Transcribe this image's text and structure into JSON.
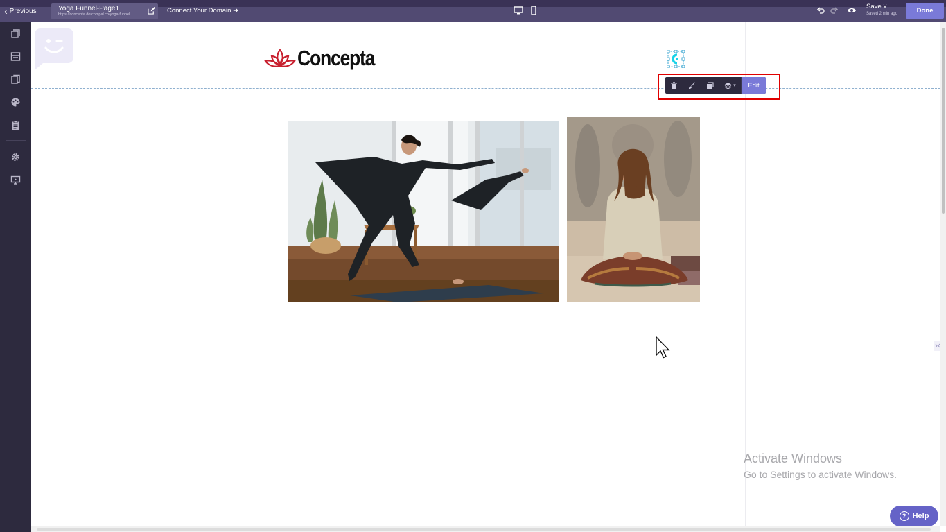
{
  "topbar": {
    "previous_label": "Previous",
    "page_name": "Yoga Funnel-Page1",
    "page_url": "https://concepta.dotcompal.co/yoga-funnel",
    "connect_domain_label": "Connect Your Domain",
    "save_label": "Save",
    "saved_status": "Saved 2 min ago",
    "done_label": "Done"
  },
  "sidebar": {
    "icons": [
      "pages-icon",
      "sections-icon",
      "templates-icon",
      "palette-icon",
      "clipboard-icon",
      "settings-icon",
      "monitor-icon"
    ]
  },
  "canvas": {
    "logo_text": "Concepta",
    "toolbar": {
      "edit_label": "Edit"
    },
    "images": [
      "woman-yoga-pose-photo",
      "man-meditating-photo"
    ]
  },
  "overlay": {
    "activate_title": "Activate Windows",
    "activate_subtitle": "Go to Settings to activate Windows.",
    "help_label": "Help"
  },
  "colors": {
    "topbar_bg": "#514a72",
    "sidebar_bg": "#2d2a3e",
    "accent": "#7a7ad8",
    "help_button": "#6563c7",
    "annotation_red": "#e00000",
    "logo_red": "#c8202f"
  }
}
